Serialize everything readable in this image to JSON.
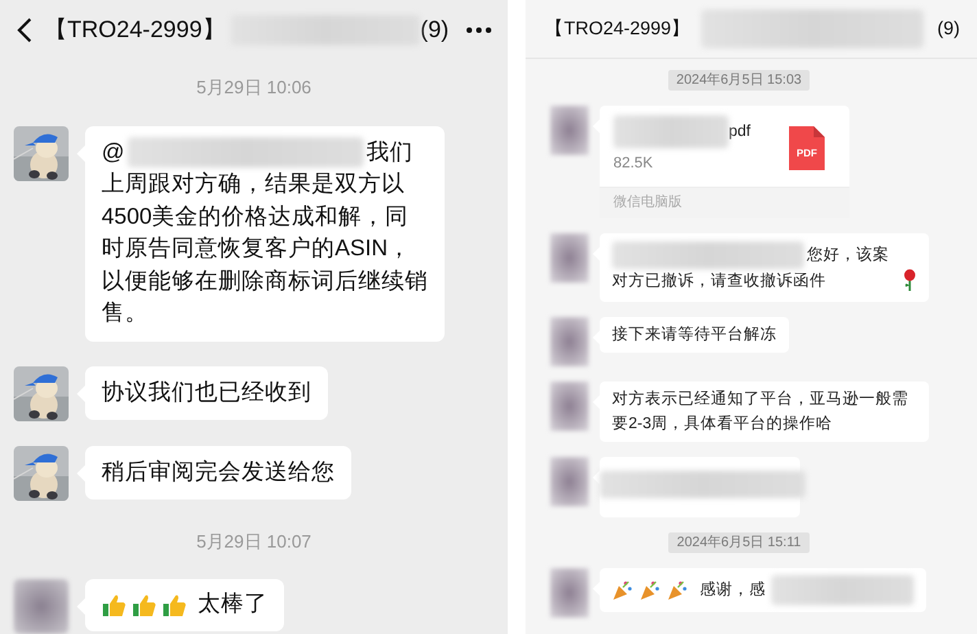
{
  "panels": [
    {
      "kind": "mobile",
      "header": {
        "title": "【TRO24-2999】",
        "name_blurred": true,
        "count": "(9)"
      },
      "messages": [
        {
          "kind": "time",
          "text": "5月29日 10:06"
        },
        {
          "kind": "mention",
          "avatar_blurred": false,
          "prefix": "@",
          "text": "我们上周跟对方确，结果是双方以4500美金的价格达成和解，同时原告同意恢复客户的ASIN，以便能够在删除商标词后继续销售。"
        },
        {
          "kind": "text",
          "avatar_blurred": false,
          "text": "协议我们也已经收到"
        },
        {
          "kind": "text",
          "avatar_blurred": false,
          "text": "稍后审阅完会发送给您"
        },
        {
          "kind": "time",
          "text": "5月29日 10:07"
        },
        {
          "kind": "thumbs",
          "avatar_blurred": true,
          "text": "太棒了"
        }
      ]
    },
    {
      "kind": "desktop",
      "header": {
        "title": "【TRO24-2999】",
        "name_blurred": true,
        "count": "(9)"
      },
      "messages": [
        {
          "kind": "time",
          "text": "2024年6月5日 15:03"
        },
        {
          "kind": "file",
          "avatar_blurred": true,
          "name_tail": "pdf",
          "size": "82.5K",
          "badge": "PDF",
          "footer": "微信电脑版"
        },
        {
          "kind": "notice",
          "avatar_blurred": true,
          "text": "您好，该案对方已撤诉，请查收撤诉函件"
        },
        {
          "kind": "text",
          "avatar_blurred": true,
          "text": "接下来请等待平台解冻"
        },
        {
          "kind": "text",
          "avatar_blurred": true,
          "text": "对方表示已经通知了平台，亚马逊一般需要2-3周，具体看平台的操作哈"
        },
        {
          "kind": "blurred",
          "avatar_blurred": true
        },
        {
          "kind": "time",
          "text": "2024年6月5日 15:11"
        },
        {
          "kind": "cheers",
          "avatar_blurred": true,
          "text": "感谢，感"
        }
      ]
    }
  ]
}
